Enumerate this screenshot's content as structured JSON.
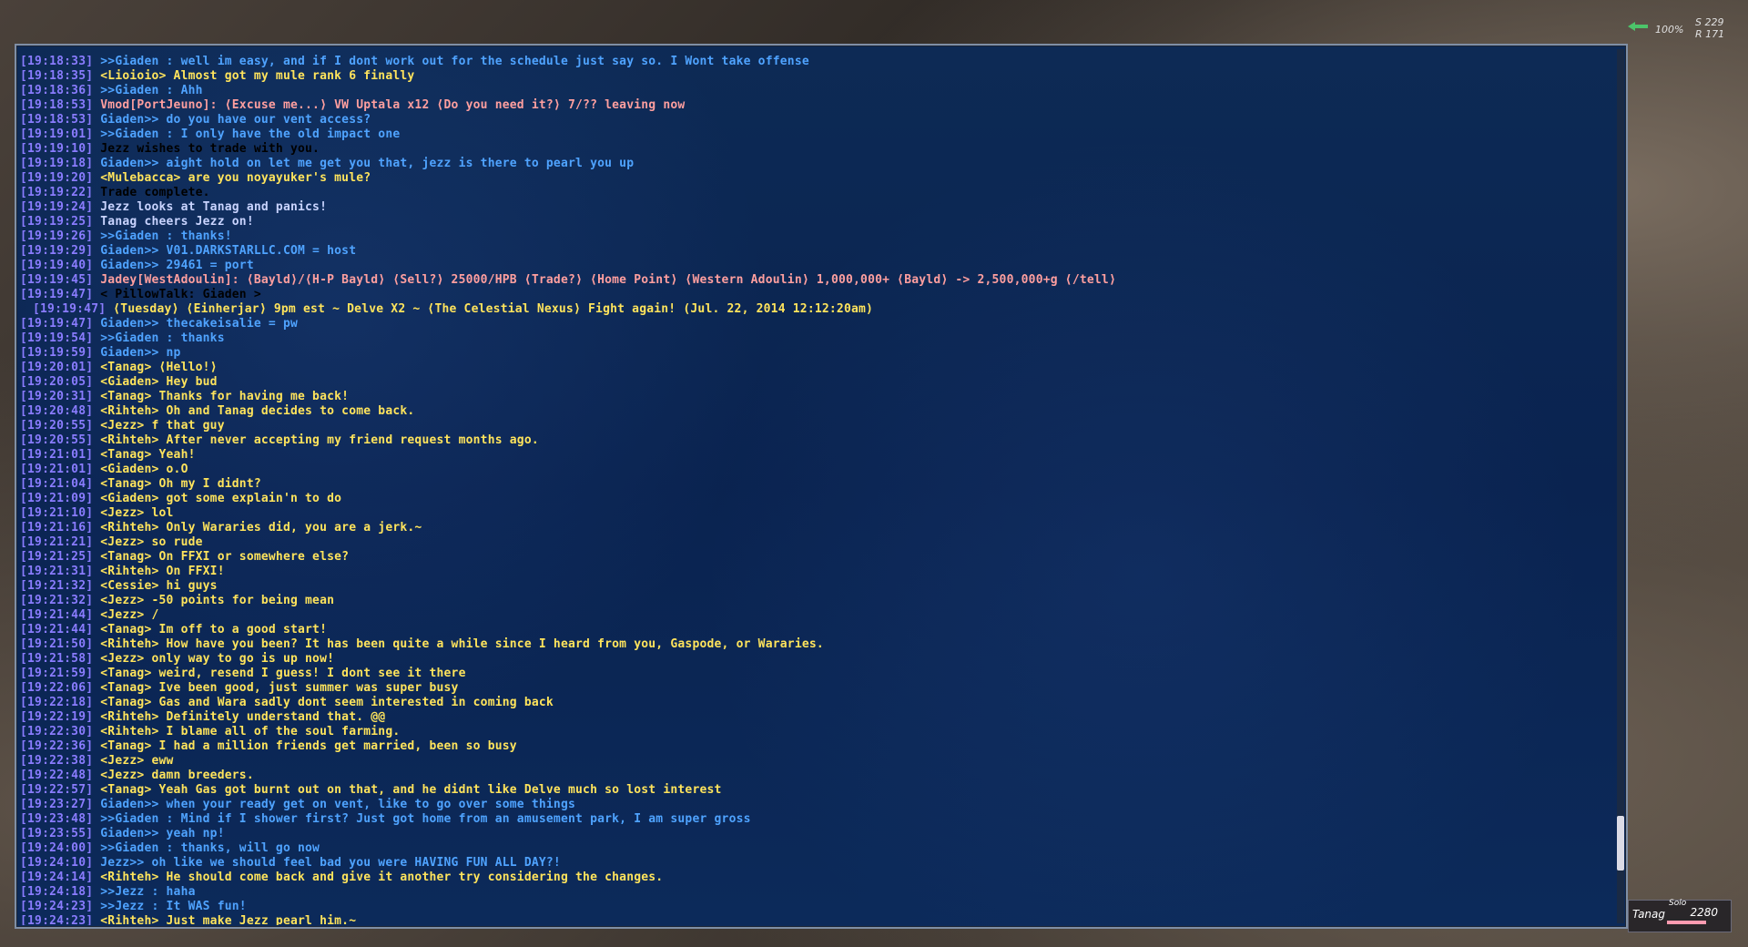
{
  "hud": {
    "compass_pct": "100%",
    "coord_s": "S 229",
    "coord_r": "R 171"
  },
  "party": {
    "mode": "Solo",
    "name": "Tanag",
    "hp": "2280",
    "hp_fraction": 0.85
  },
  "colors": {
    "timestamp": "#8a7cff",
    "tell": "#4fa3ff",
    "say": "#ffe45c",
    "system": "#ffffff",
    "shout": "#ff9f9f"
  },
  "chat_lines": [
    {
      "ts": "[19:18:33]",
      "text": ">>Giaden : well im easy, and if I dont work out for the schedule just say so.  I Wont take offense",
      "kind": "tell"
    },
    {
      "ts": "[19:18:35]",
      "text": "<Lioioio> Almost got my mule rank 6 finally",
      "kind": "say"
    },
    {
      "ts": "[19:18:36]",
      "text": ">>Giaden : Ahh",
      "kind": "tell"
    },
    {
      "ts": "[19:18:53]",
      "text": "Vmod[PortJeuno]: ⟨Excuse me...⟩ VW Uptala x12 ⟨Do you need it?⟩ 7/?? leaving now",
      "kind": "shout"
    },
    {
      "ts": "[19:18:53]",
      "text": "Giaden>> do you have our vent access?",
      "kind": "tell"
    },
    {
      "ts": "[19:19:01]",
      "text": ">>Giaden : I only have the old impact one",
      "kind": "tell"
    },
    {
      "ts": "[19:19:10]",
      "text": "Jezz wishes to trade with you.",
      "kind": "system"
    },
    {
      "ts": "[19:19:18]",
      "text": "Giaden>> aight hold on let me get you that, jezz is there to pearl you up",
      "kind": "tell"
    },
    {
      "ts": "[19:19:20]",
      "text": "<Mulebacca> are you noyayuker's mule?",
      "kind": "say"
    },
    {
      "ts": "[19:19:22]",
      "text": "Trade complete.",
      "kind": "system"
    },
    {
      "ts": "[19:19:24]",
      "text": "Jezz looks at Tanag and panics!",
      "kind": "emote"
    },
    {
      "ts": "[19:19:25]",
      "text": "Tanag cheers Jezz on!",
      "kind": "emote"
    },
    {
      "ts": "[19:19:26]",
      "text": ">>Giaden : thanks!",
      "kind": "tell"
    },
    {
      "ts": "[19:19:29]",
      "text": "Giaden>> V01.DARKSTARLLC.COM = host",
      "kind": "tell"
    },
    {
      "ts": "[19:19:40]",
      "text": "Giaden>> 29461 = port",
      "kind": "tell"
    },
    {
      "ts": "[19:19:45]",
      "text": "Jadey[WestAdoulin]: ⟨Bayld⟩/⟨H-P Bayld⟩ ⟨Sell?⟩ 25000/HPB ⟨Trade?⟩ ⟨Home Point⟩ ⟨Western Adoulin⟩ 1,000,000+ ⟨Bayld⟩ -> 2,500,000+g ⟨/tell⟩",
      "kind": "shout"
    },
    {
      "ts": "[19:19:47]",
      "text": "< PillowTalk: Giaden >",
      "kind": "system"
    },
    {
      "ts": "[19:19:47]",
      "text": "⟨Tuesday⟩ ⟨Einherjar⟩ 9pm est ~ Delve X2 ~ ⟨The Celestial Nexus⟩ Fight again!  (Jul. 22, 2014 12:12:20am)",
      "kind": "say",
      "indent": true
    },
    {
      "ts": "[19:19:47]",
      "text": "Giaden>> thecakeisalie = pw",
      "kind": "tell"
    },
    {
      "ts": "[19:19:54]",
      "text": ">>Giaden : thanks",
      "kind": "tell"
    },
    {
      "ts": "[19:19:59]",
      "text": "Giaden>> np",
      "kind": "tell"
    },
    {
      "ts": "[19:20:01]",
      "text": "<Tanag> ⟨Hello!⟩",
      "kind": "say"
    },
    {
      "ts": "[19:20:05]",
      "text": "<Giaden> Hey bud",
      "kind": "say"
    },
    {
      "ts": "[19:20:31]",
      "text": "<Tanag> Thanks for having me back!",
      "kind": "say"
    },
    {
      "ts": "[19:20:48]",
      "text": "<Rihteh> Oh and Tanag decides to come back.",
      "kind": "say"
    },
    {
      "ts": "[19:20:55]",
      "text": "<Jezz> f that guy",
      "kind": "say"
    },
    {
      "ts": "[19:20:55]",
      "text": "<Rihteh> After never accepting my friend request months ago.",
      "kind": "say"
    },
    {
      "ts": "[19:21:01]",
      "text": "<Tanag> Yeah!",
      "kind": "say"
    },
    {
      "ts": "[19:21:01]",
      "text": "<Giaden> o.O",
      "kind": "say"
    },
    {
      "ts": "[19:21:04]",
      "text": "<Tanag> Oh my I didnt?",
      "kind": "say"
    },
    {
      "ts": "[19:21:09]",
      "text": "<Giaden> got some explain'n to do",
      "kind": "say"
    },
    {
      "ts": "[19:21:10]",
      "text": "<Jezz> lol",
      "kind": "say"
    },
    {
      "ts": "[19:21:16]",
      "text": "<Rihteh> Only Wararies did, you are a jerk.~",
      "kind": "say"
    },
    {
      "ts": "[19:21:21]",
      "text": "<Jezz> so rude",
      "kind": "say"
    },
    {
      "ts": "[19:21:25]",
      "text": "<Tanag> On FFXI or somewhere else?",
      "kind": "say"
    },
    {
      "ts": "[19:21:31]",
      "text": "<Rihteh> On FFXI!",
      "kind": "say"
    },
    {
      "ts": "[19:21:32]",
      "text": "<Cessie> hi guys",
      "kind": "say"
    },
    {
      "ts": "[19:21:32]",
      "text": "<Jezz> -50 points for being mean",
      "kind": "say"
    },
    {
      "ts": "[19:21:44]",
      "text": "<Jezz> /",
      "kind": "say"
    },
    {
      "ts": "[19:21:44]",
      "text": "<Tanag> Im off to a good start!",
      "kind": "say"
    },
    {
      "ts": "[19:21:50]",
      "text": "<Rihteh> How have you been? It has been quite a while since I heard from you, Gaspode, or Wararies.",
      "kind": "say"
    },
    {
      "ts": "[19:21:58]",
      "text": "<Jezz> only way to go is up now!",
      "kind": "say"
    },
    {
      "ts": "[19:21:59]",
      "text": "<Tanag> weird, resend I guess!  I dont see it there",
      "kind": "say"
    },
    {
      "ts": "[19:22:06]",
      "text": "<Tanag> Ive been good, just summer was super busy",
      "kind": "say"
    },
    {
      "ts": "[19:22:18]",
      "text": "<Tanag> Gas and Wara sadly dont seem interested in coming back",
      "kind": "say"
    },
    {
      "ts": "[19:22:19]",
      "text": "<Rihteh> Definitely understand that. @@",
      "kind": "say"
    },
    {
      "ts": "[19:22:30]",
      "text": "<Rihteh> I blame all of the soul farming.",
      "kind": "say"
    },
    {
      "ts": "[19:22:36]",
      "text": "<Tanag> I had a million friends get married, been so busy",
      "kind": "say"
    },
    {
      "ts": "[19:22:38]",
      "text": "<Jezz> eww",
      "kind": "say"
    },
    {
      "ts": "[19:22:48]",
      "text": "<Jezz> damn breeders.",
      "kind": "say"
    },
    {
      "ts": "[19:22:57]",
      "text": "<Tanag> Yeah Gas got burnt out on that, and he didnt like Delve much so lost interest",
      "kind": "say"
    },
    {
      "ts": "[19:23:27]",
      "text": "Giaden>> when your ready get on vent, like to go over some things",
      "kind": "tell"
    },
    {
      "ts": "[19:23:48]",
      "text": ">>Giaden : Mind if I shower first?  Just got home from an amusement park, I am super gross",
      "kind": "tell"
    },
    {
      "ts": "[19:23:55]",
      "text": "Giaden>> yeah np!",
      "kind": "tell"
    },
    {
      "ts": "[19:24:00]",
      "text": ">>Giaden : thanks, will go now",
      "kind": "tell"
    },
    {
      "ts": "[19:24:10]",
      "text": "Jezz>> oh like we should feel bad you were HAVING FUN ALL DAY?!",
      "kind": "tell"
    },
    {
      "ts": "[19:24:14]",
      "text": "<Rihteh> He should come back and give it another try considering the changes.",
      "kind": "say"
    },
    {
      "ts": "[19:24:18]",
      "text": ">>Jezz : haha",
      "kind": "tell"
    },
    {
      "ts": "[19:24:23]",
      "text": ">>Jezz : It WAS fun!",
      "kind": "tell"
    },
    {
      "ts": "[19:24:23]",
      "text": "<Rihteh> Just make Jezz pearl him.~",
      "kind": "say"
    }
  ]
}
